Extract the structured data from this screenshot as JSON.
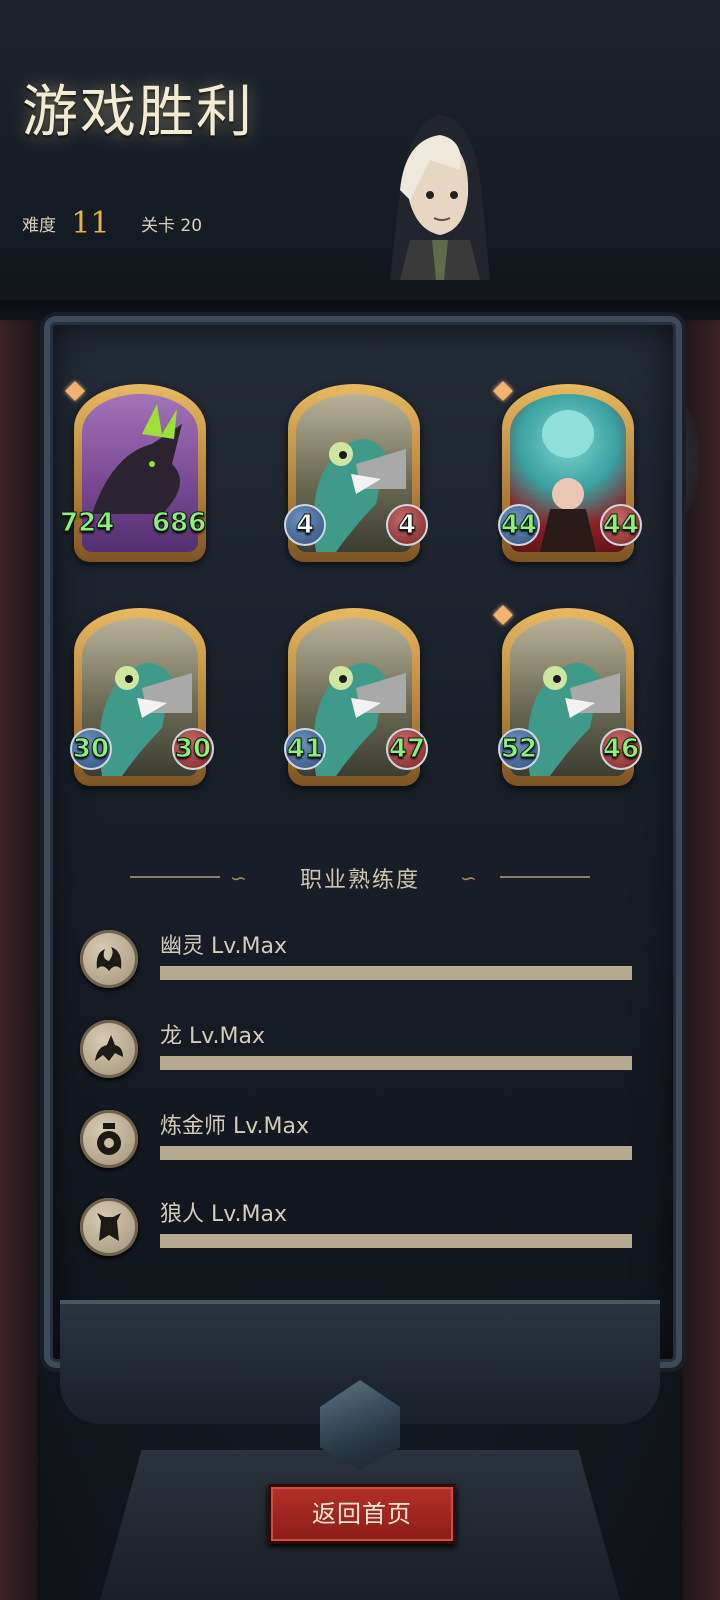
{
  "header": {
    "title": "游戏胜利",
    "difficulty_label": "难度",
    "difficulty_value": "11",
    "stage_label": "关卡 20"
  },
  "cards": [
    {
      "type": "wolf",
      "atk": "724",
      "hp": "686"
    },
    {
      "type": "dragon",
      "atk": "4",
      "hp": "4"
    },
    {
      "type": "ghost",
      "atk": "44",
      "hp": "44"
    },
    {
      "type": "dragon",
      "atk": "30",
      "hp": "30"
    },
    {
      "type": "dragon",
      "atk": "41",
      "hp": "47"
    },
    {
      "type": "dragon",
      "atk": "52",
      "hp": "46"
    }
  ],
  "mastery": {
    "title": "职业熟练度",
    "items": [
      {
        "label": "幽灵 Lv.Max",
        "icon": "ghost-class-icon",
        "progress": 1.0
      },
      {
        "label": "龙 Lv.Max",
        "icon": "dragon-class-icon",
        "progress": 1.0
      },
      {
        "label": "炼金师 Lv.Max",
        "icon": "alchemist-class-icon",
        "progress": 1.0
      },
      {
        "label": "狼人 Lv.Max",
        "icon": "werewolf-class-icon",
        "progress": 1.0
      }
    ]
  },
  "return_button": "返回首页",
  "colors": {
    "accent_gold": "#e7b24a",
    "stat_green": "#8df07a",
    "button_red": "#a3261f"
  }
}
